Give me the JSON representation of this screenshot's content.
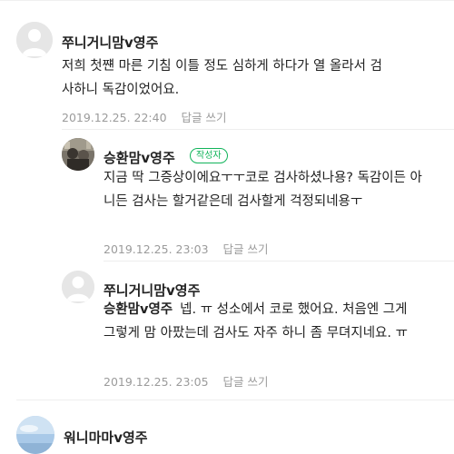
{
  "comments": [
    {
      "author": "쭈니거니맘v영주",
      "avatar": "default-avatar-icon",
      "text": "저희 첫쨴 마른 기침 이틀 정도 심하게 하다가 열 올라서 검사하니 독감이었어요.",
      "date": "2019.12.25. 22:40",
      "reply_label": "답글 쓰기"
    },
    {
      "author": "승환맘v영주",
      "badge": "작성자",
      "avatar": "profile-photo-avatar",
      "text": "지금 딱 그증상이에요ㅜㅜ코로 검사하셨나용? 독감이든 아니든 검사는 할거같은데 검사할게 걱정되네용ㅜ",
      "date": "2019.12.25. 23:03",
      "reply_label": "답글 쓰기"
    },
    {
      "author": "쭈니거니맘v영주",
      "avatar": "default-avatar-icon",
      "mention": "승환맘v영주",
      "text": "넵. ㅠ 성소에서 코로 했어요. 처음엔 그게 그렇게 맘 아팠는데 검사도 자주 하니 좀 무뎌지네요. ㅠ",
      "date": "2019.12.25. 23:05",
      "reply_label": "답글 쓰기"
    },
    {
      "author": "워니마마v영주",
      "avatar": "sky-photo-avatar"
    }
  ],
  "colors": {
    "badge_green": "#11b45a",
    "meta_gray": "#9b9b9b",
    "text": "#222222"
  }
}
